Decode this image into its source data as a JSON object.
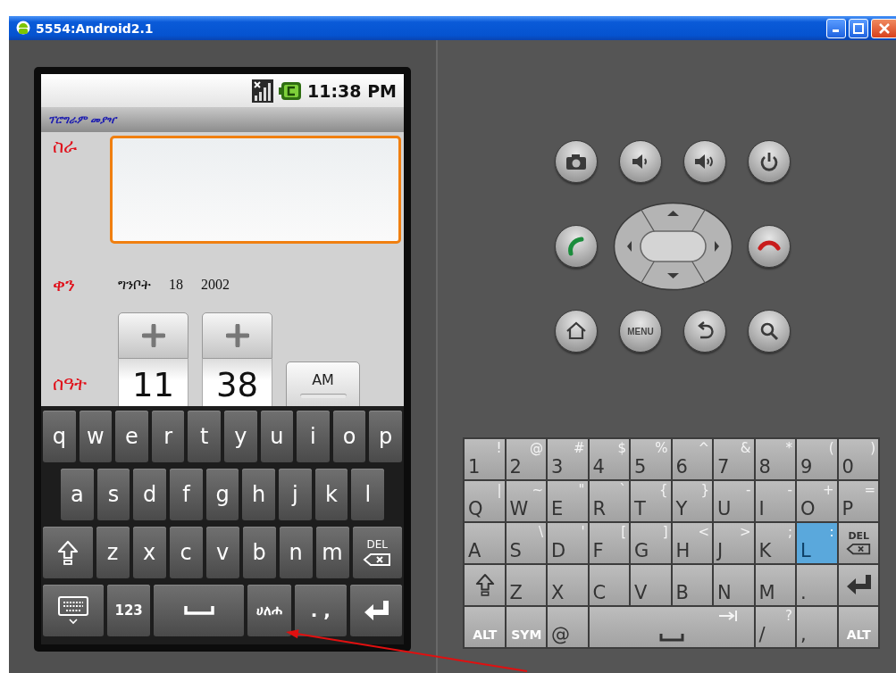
{
  "window": {
    "title": "5554:Android2.1"
  },
  "status_bar": {
    "time": "11:38 PM"
  },
  "app": {
    "title": "ፕሮግራም መያዣ",
    "task": {
      "label": "ስራ",
      "focused": true
    },
    "date": {
      "label": "ቀን",
      "month": "ግንቦት",
      "day": "18",
      "year": "2002"
    },
    "time": {
      "label": "ሰዓት",
      "hour": "11",
      "minute": "38",
      "period": "AM"
    }
  },
  "soft_keyboard": {
    "rows": [
      {
        "keys": [
          {
            "kind": "char",
            "label": "q"
          },
          {
            "kind": "char",
            "label": "w"
          },
          {
            "kind": "char",
            "label": "e"
          },
          {
            "kind": "char",
            "label": "r"
          },
          {
            "kind": "char",
            "label": "t"
          },
          {
            "kind": "char",
            "label": "y"
          },
          {
            "kind": "char",
            "label": "u"
          },
          {
            "kind": "char",
            "label": "i"
          },
          {
            "kind": "char",
            "label": "o"
          },
          {
            "kind": "char",
            "label": "p"
          }
        ]
      },
      {
        "keys": [
          {
            "kind": "char",
            "label": "a"
          },
          {
            "kind": "char",
            "label": "s"
          },
          {
            "kind": "char",
            "label": "d"
          },
          {
            "kind": "char",
            "label": "f"
          },
          {
            "kind": "char",
            "label": "g"
          },
          {
            "kind": "char",
            "label": "h"
          },
          {
            "kind": "char",
            "label": "j"
          },
          {
            "kind": "char",
            "label": "k"
          },
          {
            "kind": "char",
            "label": "l"
          }
        ]
      },
      {
        "keys": [
          {
            "kind": "shift"
          },
          {
            "kind": "char",
            "label": "z"
          },
          {
            "kind": "char",
            "label": "x"
          },
          {
            "kind": "char",
            "label": "c"
          },
          {
            "kind": "char",
            "label": "v"
          },
          {
            "kind": "char",
            "label": "b"
          },
          {
            "kind": "char",
            "label": "n"
          },
          {
            "kind": "char",
            "label": "m"
          },
          {
            "kind": "del",
            "label": "DEL"
          }
        ]
      },
      {
        "keys": [
          {
            "kind": "keyboard"
          },
          {
            "kind": "mode",
            "label": "123"
          },
          {
            "kind": "space"
          },
          {
            "kind": "mode",
            "label": "ሀለሐ"
          },
          {
            "kind": "char",
            "label": ". ,"
          },
          {
            "kind": "enter"
          }
        ]
      }
    ]
  },
  "hardware_buttons": {
    "menu_label": "MENU"
  },
  "hardware_keyboard": {
    "rows": [
      {
        "keys": [
          {
            "kind": "char",
            "label": "1",
            "alt": "!",
            "pressed": false
          },
          {
            "kind": "char",
            "label": "2",
            "alt": "@",
            "pressed": false
          },
          {
            "kind": "char",
            "label": "3",
            "alt": "#",
            "pressed": false
          },
          {
            "kind": "char",
            "label": "4",
            "alt": "$",
            "pressed": false
          },
          {
            "kind": "char",
            "label": "5",
            "alt": "%",
            "pressed": false
          },
          {
            "kind": "char",
            "label": "6",
            "alt": "^",
            "pressed": false
          },
          {
            "kind": "char",
            "label": "7",
            "alt": "&",
            "pressed": false
          },
          {
            "kind": "char",
            "label": "8",
            "alt": "*",
            "pressed": false
          },
          {
            "kind": "char",
            "label": "9",
            "alt": "(",
            "pressed": false
          },
          {
            "kind": "char",
            "label": "0",
            "alt": ")",
            "pressed": false
          }
        ]
      },
      {
        "keys": [
          {
            "kind": "char",
            "label": "Q",
            "alt": "|",
            "pressed": false
          },
          {
            "kind": "char",
            "label": "W",
            "alt": "~",
            "pressed": false
          },
          {
            "kind": "char",
            "label": "E",
            "alt": "\"",
            "pressed": false
          },
          {
            "kind": "char",
            "label": "R",
            "alt": "`",
            "pressed": false
          },
          {
            "kind": "char",
            "label": "T",
            "alt": "{",
            "pressed": false
          },
          {
            "kind": "char",
            "label": "Y",
            "alt": "}",
            "pressed": false
          },
          {
            "kind": "char",
            "label": "U",
            "alt": "-",
            "pressed": false
          },
          {
            "kind": "char",
            "label": "I",
            "alt": "-",
            "pressed": false
          },
          {
            "kind": "char",
            "label": "O",
            "alt": "+",
            "pressed": false
          },
          {
            "kind": "char",
            "label": "P",
            "alt": "=",
            "pressed": false
          }
        ]
      },
      {
        "keys": [
          {
            "kind": "char",
            "label": "A",
            "pressed": false
          },
          {
            "kind": "char",
            "label": "S",
            "alt": "\\",
            "pressed": false
          },
          {
            "kind": "char",
            "label": "D",
            "alt": "'",
            "pressed": false
          },
          {
            "kind": "char",
            "label": "F",
            "alt": "[",
            "pressed": false
          },
          {
            "kind": "char",
            "label": "G",
            "alt": "]",
            "pressed": false
          },
          {
            "kind": "char",
            "label": "H",
            "alt": "<",
            "pressed": false
          },
          {
            "kind": "char",
            "label": "J",
            "alt": ">",
            "pressed": false
          },
          {
            "kind": "char",
            "label": "K",
            "alt": ";",
            "pressed": false
          },
          {
            "kind": "char",
            "label": "L",
            "alt": ":",
            "pressed": true
          },
          {
            "kind": "del",
            "label": "DEL",
            "pressed": false
          }
        ]
      },
      {
        "keys": [
          {
            "kind": "shift",
            "pressed": false
          },
          {
            "kind": "char",
            "label": "Z",
            "pressed": false
          },
          {
            "kind": "char",
            "label": "X",
            "pressed": false
          },
          {
            "kind": "char",
            "label": "C",
            "pressed": false
          },
          {
            "kind": "char",
            "label": "V",
            "pressed": false
          },
          {
            "kind": "char",
            "label": "B",
            "pressed": false
          },
          {
            "kind": "char",
            "label": "N",
            "pressed": false
          },
          {
            "kind": "char",
            "label": "M",
            "pressed": false
          },
          {
            "kind": "char",
            "label": ".",
            "pressed": false
          },
          {
            "kind": "enter",
            "pressed": false
          }
        ]
      },
      {
        "keys": [
          {
            "kind": "mod",
            "label": "ALT",
            "pressed": false
          },
          {
            "kind": "mod",
            "label": "SYM",
            "pressed": false
          },
          {
            "kind": "char",
            "label": "@",
            "pressed": false
          },
          {
            "kind": "space",
            "pressed": false
          },
          {
            "kind": "char",
            "label": "/",
            "alt": "?",
            "pressed": false
          },
          {
            "kind": "char",
            "label": ",",
            "pressed": false
          },
          {
            "kind": "mod",
            "label": "ALT",
            "pressed": false
          }
        ]
      }
    ]
  }
}
